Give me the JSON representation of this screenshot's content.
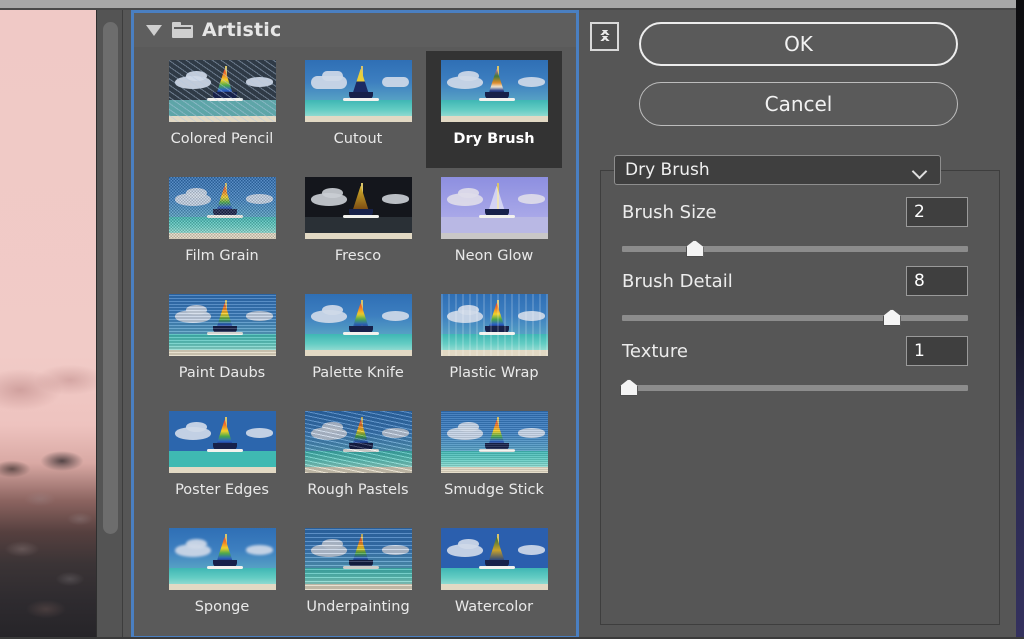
{
  "window": {
    "background_color": "#565656",
    "accent_color": "#4a7fc1"
  },
  "preview": {
    "name": "image-preview",
    "description": "pink sky over dark rocky shoreline"
  },
  "scrollbar": {
    "name": "vertical-scrollbar"
  },
  "gallery": {
    "disclosure_state": "expanded",
    "category_label": "Artistic",
    "selected_filter": "Dry Brush",
    "filters": [
      {
        "label": "Colored Pencil",
        "art": "t-pencil"
      },
      {
        "label": "Cutout",
        "art": "t-cutout"
      },
      {
        "label": "Dry Brush",
        "art": "t-drybrush"
      },
      {
        "label": "Film Grain",
        "art": "t-filmgrain"
      },
      {
        "label": "Fresco",
        "art": "t-fresco"
      },
      {
        "label": "Neon Glow",
        "art": "t-neon"
      },
      {
        "label": "Paint Daubs",
        "art": "t-paintdaubs"
      },
      {
        "label": "Palette Knife",
        "art": "t-palette"
      },
      {
        "label": "Plastic Wrap",
        "art": "t-plastic"
      },
      {
        "label": "Poster Edges",
        "art": "t-poster"
      },
      {
        "label": "Rough Pastels",
        "art": "t-rough"
      },
      {
        "label": "Smudge Stick",
        "art": "t-smudge"
      },
      {
        "label": "Sponge",
        "art": "t-sponge"
      },
      {
        "label": "Underpainting",
        "art": "t-under"
      },
      {
        "label": "Watercolor",
        "art": "t-water"
      }
    ]
  },
  "controls": {
    "collapse_icon": "double-chevron-up-icon",
    "ok_label": "OK",
    "cancel_label": "Cancel",
    "filter_select": {
      "value": "Dry Brush",
      "caret_icon": "chevron-down-icon"
    },
    "sliders": [
      {
        "label": "Brush Size",
        "value": "2",
        "percent": 21
      },
      {
        "label": "Brush Detail",
        "value": "8",
        "percent": 78
      },
      {
        "label": "Texture",
        "value": "1",
        "percent": 2
      }
    ]
  }
}
